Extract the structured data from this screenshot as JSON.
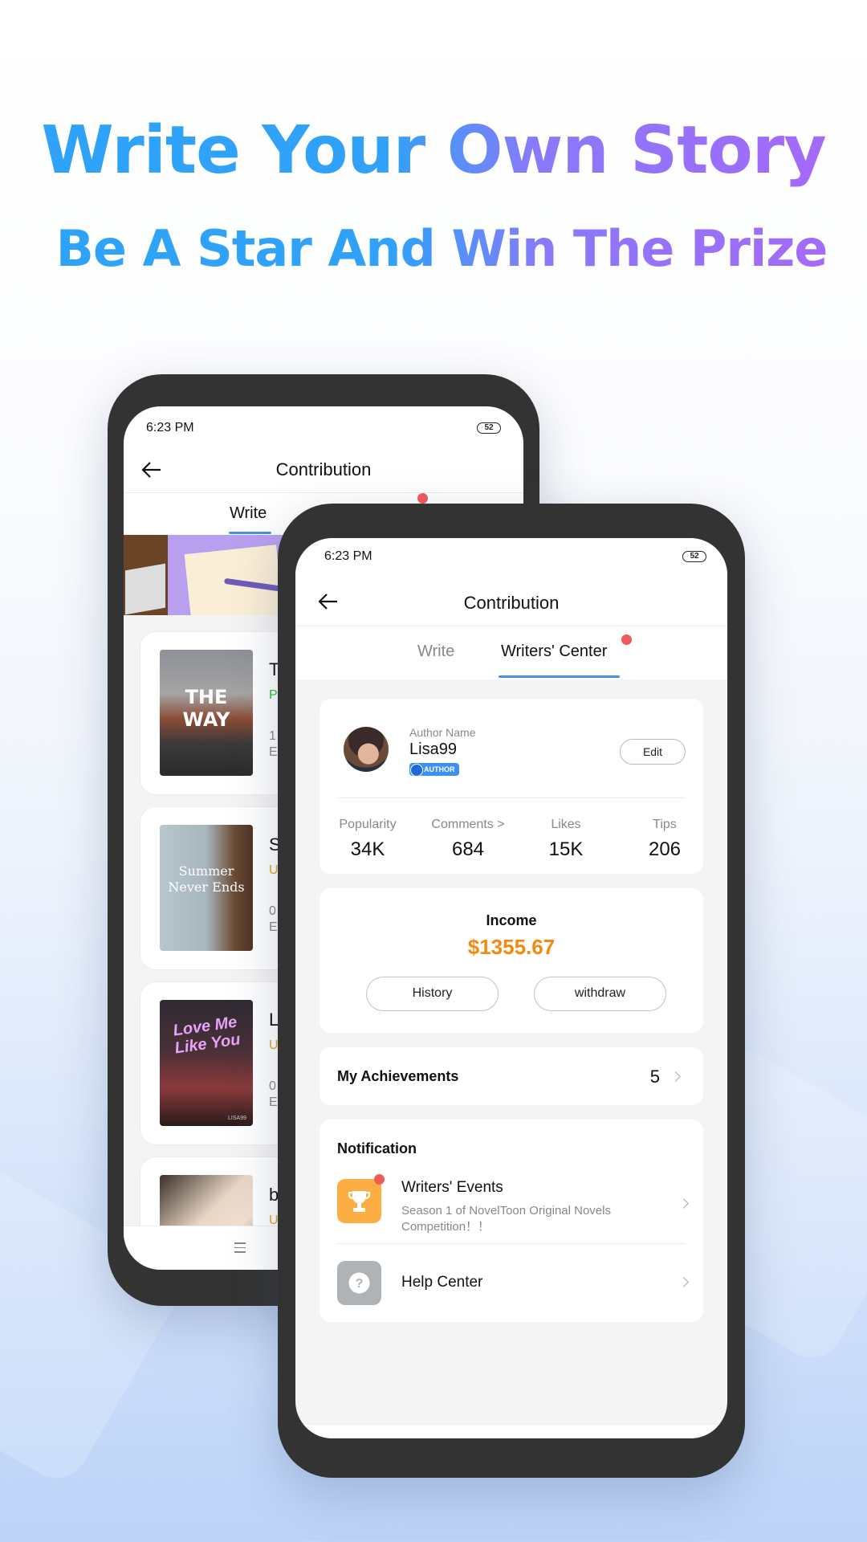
{
  "headline": {
    "title": "Write Your Own Story",
    "subtitle": "Be A Star And Win The Prize",
    "gradient_colors": [
      "#2ea3f9",
      "#a967f9"
    ]
  },
  "back_phone": {
    "status_time": "6:23 PM",
    "battery": "52",
    "nav_title": "Contribution",
    "tabs": [
      {
        "label": "Write",
        "active": true
      }
    ],
    "books": [
      {
        "title_visible": "T",
        "status_visible": "Pa",
        "status_color": "#3fb53f",
        "count": "1",
        "eps_visible": "Ep",
        "cover_text": "THE WAY"
      },
      {
        "title_visible": "S",
        "status_visible": "Ur",
        "status_color": "#e0a020",
        "count": "0",
        "eps_visible": "Ep",
        "cover_text": "Summer Never Ends"
      },
      {
        "title_visible": "Lo",
        "status_visible": "Ur",
        "status_color": "#e0a020",
        "count": "0",
        "eps_visible": "Ep",
        "cover_text": "Love Me Like You",
        "cover_author": "LISA99"
      },
      {
        "title_visible": "b",
        "status_visible": "Ur",
        "status_color": "#e0a020"
      }
    ]
  },
  "front_phone": {
    "status_time": "6:23 PM",
    "battery": "52",
    "nav_title": "Contribution",
    "tabs": [
      {
        "label": "Write",
        "active": false
      },
      {
        "label": "Writers' Center",
        "active": true,
        "has_badge": true
      }
    ],
    "author": {
      "label": "Author Name",
      "name": "Lisa99",
      "badge": "AUTHOR",
      "edit_label": "Edit"
    },
    "stats": [
      {
        "label": "Popularity",
        "value": "34K"
      },
      {
        "label": "Comments >",
        "value": "684"
      },
      {
        "label": "Likes",
        "value": "15K"
      },
      {
        "label": "Tips",
        "value": "206"
      }
    ],
    "income": {
      "label": "Income",
      "value": "$1355.67",
      "history_label": "History",
      "withdraw_label": "withdraw"
    },
    "achievements": {
      "label": "My Achievements",
      "count": "5"
    },
    "notification": {
      "heading": "Notification",
      "items": [
        {
          "title": "Writers' Events",
          "subtitle": "Season 1 of NovelToon Original Novels Competition！！",
          "icon": "trophy-icon",
          "has_badge": true
        },
        {
          "title": "Help Center",
          "icon": "help-icon",
          "has_badge": false
        }
      ]
    }
  }
}
